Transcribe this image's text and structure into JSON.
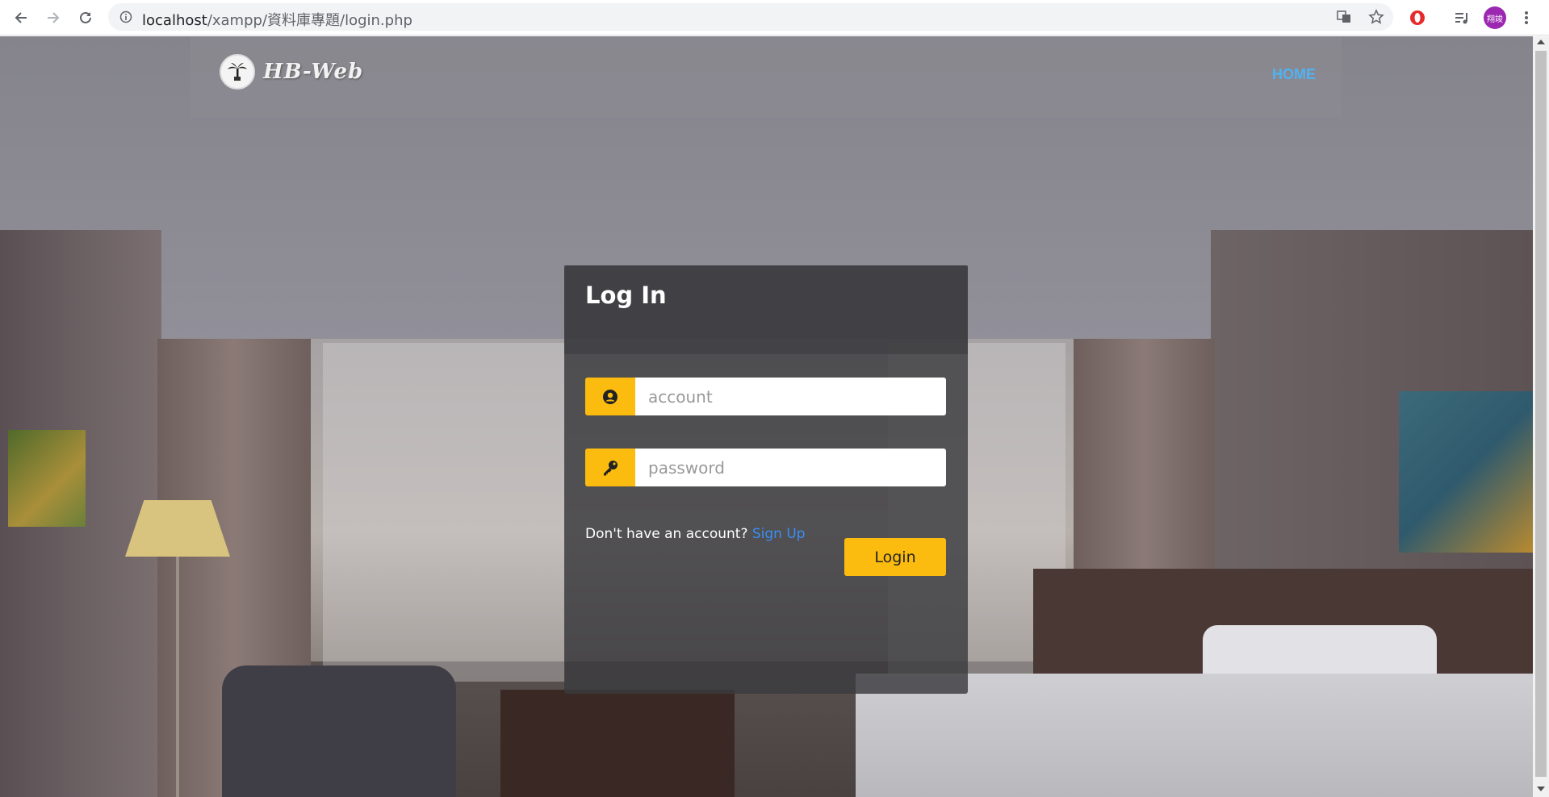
{
  "browser": {
    "url_host": "localhost",
    "url_path": "/xampp/資料庫專題/login.php",
    "avatar_label": "翔竣",
    "icons": [
      "back-icon",
      "forward-icon",
      "reload-icon",
      "info-icon",
      "translate-icon",
      "star-icon",
      "opera-extension-icon",
      "media-queue-icon",
      "menu-kebab-icon"
    ]
  },
  "navbar": {
    "logo_text": "HB-Web",
    "home_label": "HOME",
    "home_color": "#4fb3f2"
  },
  "login": {
    "title": "Log In",
    "account_placeholder": "account",
    "password_placeholder": "password",
    "signup_prompt": "Don't have an account?",
    "signup_link": "Sign Up",
    "login_button": "Login",
    "accent_color": "#fbbc0f",
    "link_color": "#3a8ef5"
  }
}
